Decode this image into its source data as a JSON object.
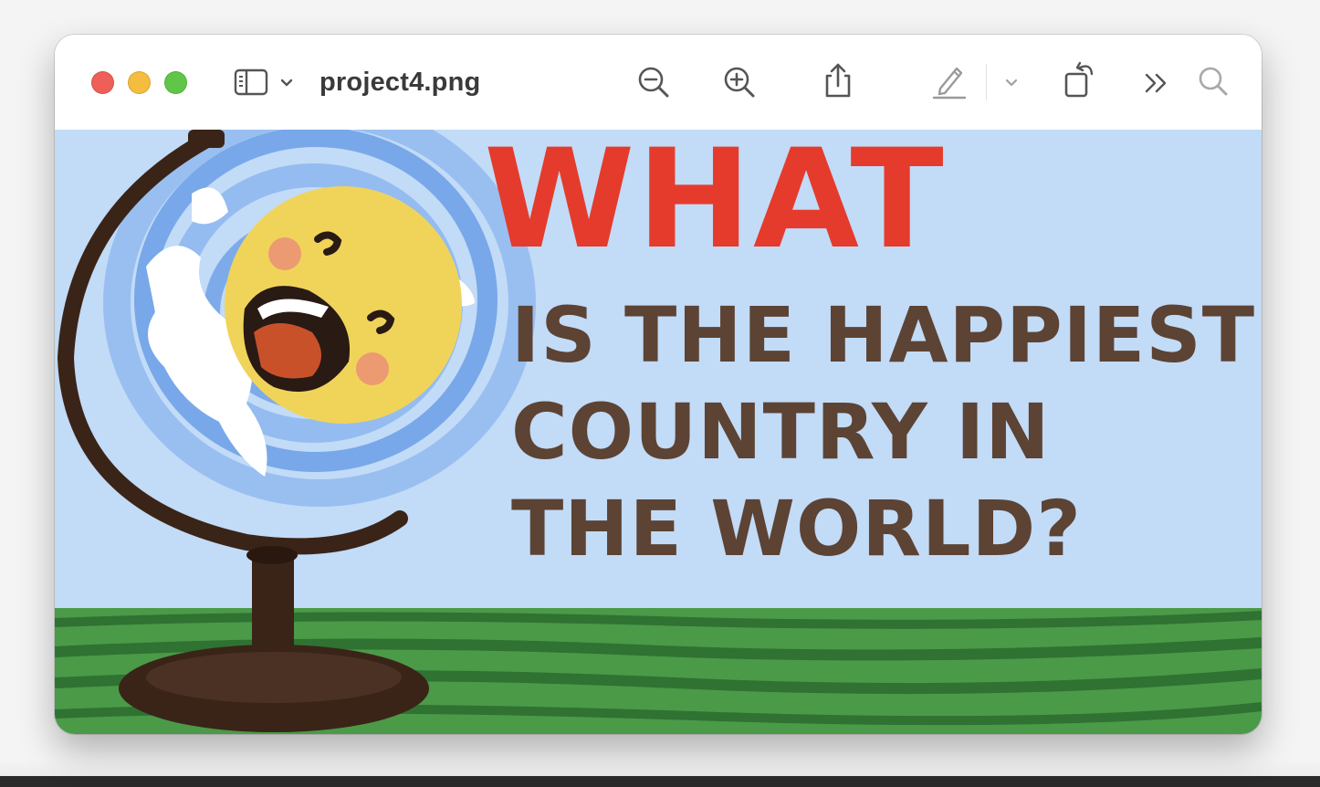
{
  "window": {
    "title": "project4.png"
  },
  "toolbar": {
    "icons": [
      "sidebar-icon",
      "chevron-down-icon",
      "zoom-out-icon",
      "zoom-in-icon",
      "share-icon",
      "markup-pen-icon",
      "chevron-down-icon",
      "rotate-icon",
      "overflow-chevrons-icon",
      "search-icon"
    ]
  },
  "image": {
    "headline_top": "WHAT",
    "headline_line1": "IS THE HAPPIEST",
    "headline_line2": "COUNTRY IN",
    "headline_line3": "THE WORLD?",
    "colors": {
      "sky": "#c2dbf7",
      "title_red": "#e53b2c",
      "title_brown": "#5c4334",
      "grass": "#4a9a48",
      "globe_blue": "#6b9fe6",
      "face_yellow": "#f0d45a",
      "stand_brown": "#3a2418"
    }
  },
  "traffic_lights": {
    "close": "#ee5f57",
    "minimize": "#f4bd3f",
    "zoom": "#5fc648"
  }
}
